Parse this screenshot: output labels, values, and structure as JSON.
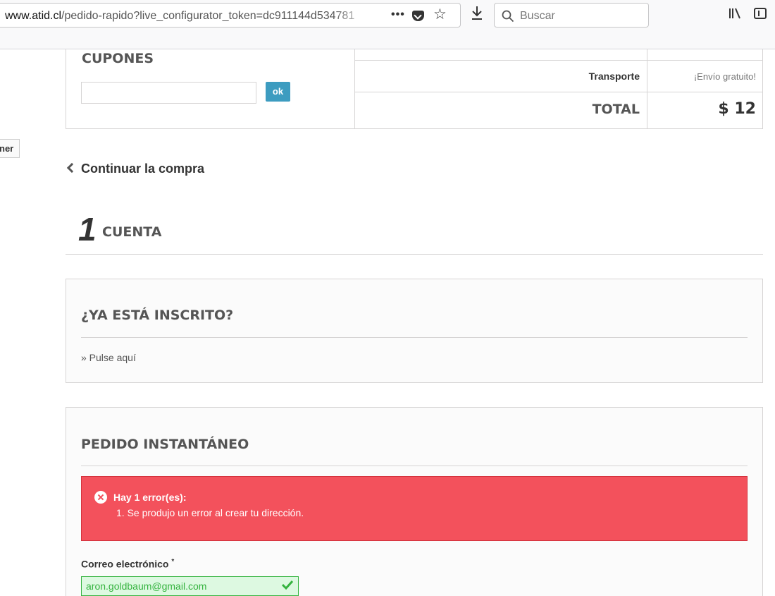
{
  "browser": {
    "url_host": "www.atid.cl",
    "url_path": "/pedido-rapido?live_configurator_token=dc911144d534781",
    "page_actions": "•••",
    "search_placeholder": "Buscar"
  },
  "side_button": {
    "label": "ner"
  },
  "cart_summary": {
    "coupons_title": "CUPONES",
    "coupon_input_value": "",
    "coupon_submit_label": "ok",
    "transport_label": "Transporte",
    "transport_value": "¡Envío gratuito!",
    "total_label": "TOTAL",
    "total_value": "$ 12"
  },
  "continue_link": "Continuar la compra",
  "step": {
    "number": "1",
    "title": "CUENTA"
  },
  "login_panel": {
    "title": "¿YA ESTÁ INSCRITO?",
    "link": "» Pulse aquí"
  },
  "order_panel": {
    "title": "PEDIDO INSTANTÁNEO",
    "error_title": "Hay 1 error(es):",
    "error_items": [
      "1. Se produjo un error al crear tu dirección."
    ],
    "email_label": "Correo electrónico",
    "email_required_mark": "*",
    "email_value": "aron.goldbaum@gmail.com"
  },
  "colors": {
    "accent_button": "#3d9cc0",
    "error_background": "#f3515c",
    "success_green": "#35b33f",
    "success_background": "#ddf9e1"
  }
}
